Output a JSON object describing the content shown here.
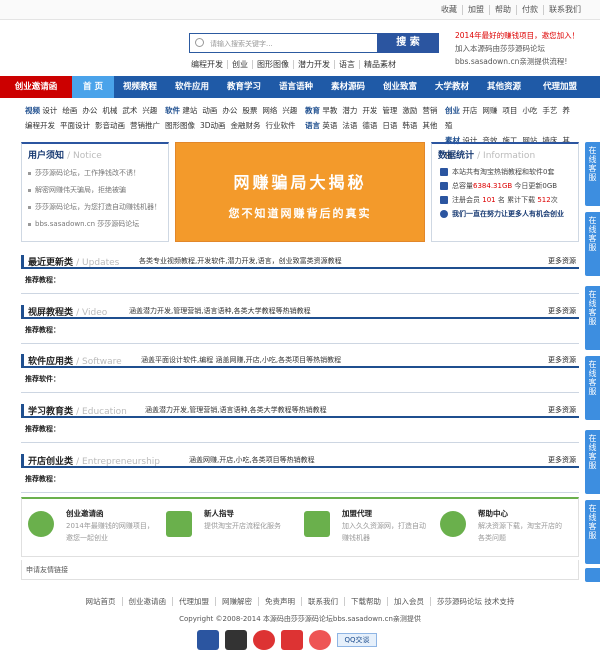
{
  "toplinks": [
    "收藏",
    "加盟",
    "帮助",
    "付款",
    "联系我们"
  ],
  "search": {
    "placeholder": "请输入搜索关键字...",
    "button": "搜 索"
  },
  "hotwords": [
    "编程开发",
    "创业",
    "图形图像",
    "潜力开发",
    "语言",
    "精品素材"
  ],
  "promo": {
    "line1": "2014年最好的赚钱项目，邀您加入！",
    "line2": "加入本源码由莎莎源码论坛",
    "line3": "bbs.sasadown.cn亲测提供流程!"
  },
  "nav": [
    "创业邀请函",
    "首 页",
    "视频教程",
    "软件应用",
    "教育学习",
    "语言语种",
    "素材源码",
    "创业致富",
    "大学教材",
    "其他资源",
    "代理加盟"
  ],
  "subnav": {
    "g1": {
      "label": "视频",
      "r1": [
        "设计",
        "绘画",
        "办公",
        "机械",
        "武术",
        "兴趣"
      ],
      "label2": "",
      "r2": [
        "编程开发",
        "平面设计",
        "影音动画",
        "营销推广"
      ]
    },
    "g2": {
      "label": "软件",
      "r1": [
        "建站",
        "动画",
        "办公",
        "股票",
        "网络",
        "兴趣"
      ],
      "r2": [
        "图形图像",
        "3D动画",
        "金融财务",
        "行业软件"
      ]
    },
    "g3": {
      "label": "教育",
      "r1": [
        "早教",
        "潜力",
        "开发",
        "管理",
        "激励",
        "营销"
      ],
      "label2": "语言",
      "r2": [
        "英语",
        "法语",
        "德语",
        "日语",
        "韩语",
        "其他"
      ]
    },
    "g4": {
      "label": "创业",
      "r1": [
        "开店",
        "网赚",
        "项目",
        "小吃",
        "手艺",
        "养殖"
      ],
      "label2": "素材",
      "r2": [
        "设计",
        "音效",
        "施工",
        "网站",
        "墙床",
        "其他"
      ]
    }
  },
  "notice": {
    "title": "用户须知",
    "sub": "/ Notice",
    "items": [
      "莎莎源码论坛，工作挣钱改不诱！",
      "解密网赚伟天骗局，拒绝被骗",
      "莎莎源码论坛，为您打造自动赚钱机器！",
      "bbs.sasadown.cn 莎莎源码论坛"
    ]
  },
  "banner": {
    "t1": "网赚骗局大揭秘",
    "t2": "您不知道网赚背后的真实"
  },
  "stats": {
    "title": "数据统计",
    "sub": "/ Information",
    "l1": "本站共有淘宝热销教程和软件0套",
    "l2a": "总容量",
    "l2b": "6384.31GB",
    "l2c": "今日更新0GB",
    "l3a": "注册会员",
    "l3b": "101",
    "l3c": "名 累计下载",
    "l3d": "512",
    "l3e": "次",
    "l4": "我们一直在努力让更多人有机会创业"
  },
  "sidetab": "在线客服",
  "sections": [
    {
      "title": "最近更新类",
      "sub": "/ Updates",
      "desc": "各类专业视频教程,开发软件,潜力开发,语言，创业致富类资源教程",
      "more": "更多资源",
      "rec": "推荐教程："
    },
    {
      "title": "视屏教程类",
      "sub": "/ Video",
      "desc": "涵盖潜力开发,管理营销,语言语种,各类大学教程等热销教程",
      "more": "更多资源",
      "rec": "推荐教程："
    },
    {
      "title": "软件应用类",
      "sub": "/ Software",
      "desc": "涵盖平面设计软件,编程   涵盖网赚,开店,小吃,各类项目等热销教程",
      "more": "更多资源",
      "rec": "推荐软件："
    },
    {
      "title": "学习教育类",
      "sub": "/ Education",
      "desc": "涵盖潜力开发,管理营销,语言语种,各类大学教程等热销教程",
      "more": "更多资源",
      "rec": "推荐教程："
    },
    {
      "title": "开店创业类",
      "sub": "/ Entrepreneurship",
      "desc": "涵盖网赚,开店,小吃,各类项目等热销教程",
      "more": "更多资源",
      "rec": "推荐教程："
    }
  ],
  "services": [
    {
      "name": "创业邀请函",
      "desc": "2014年最赚钱的网赚项目，邀您一起创业"
    },
    {
      "name": "新人指导",
      "desc": "提供淘宝开店流程化服务"
    },
    {
      "name": "加盟代理",
      "desc": "加入久久资源网，打造自动赚钱机器"
    },
    {
      "name": "帮助中心",
      "desc": "解决资源下载，淘宝开店的各类问题"
    }
  ],
  "friendlinks": "申请友情链接",
  "footerlinks": [
    "网站首页",
    "创业邀请函",
    "代理加盟",
    "网赚解密",
    "免责声明",
    "联系我们",
    "下载帮助",
    "加入会员",
    "莎莎源码论坛 技术支持"
  ],
  "copyright": "Copyright ©2008-2014 本源码由莎莎源码论坛bbs.sasadown.cn亲测提供",
  "qq": "QQ交谈",
  "colors": {
    "nav": "#1f5aa7",
    "navRed": "#cc0000",
    "navCur": "#4aa3ea",
    "banner": "#f39a2b",
    "accent": "#2b55a0"
  }
}
